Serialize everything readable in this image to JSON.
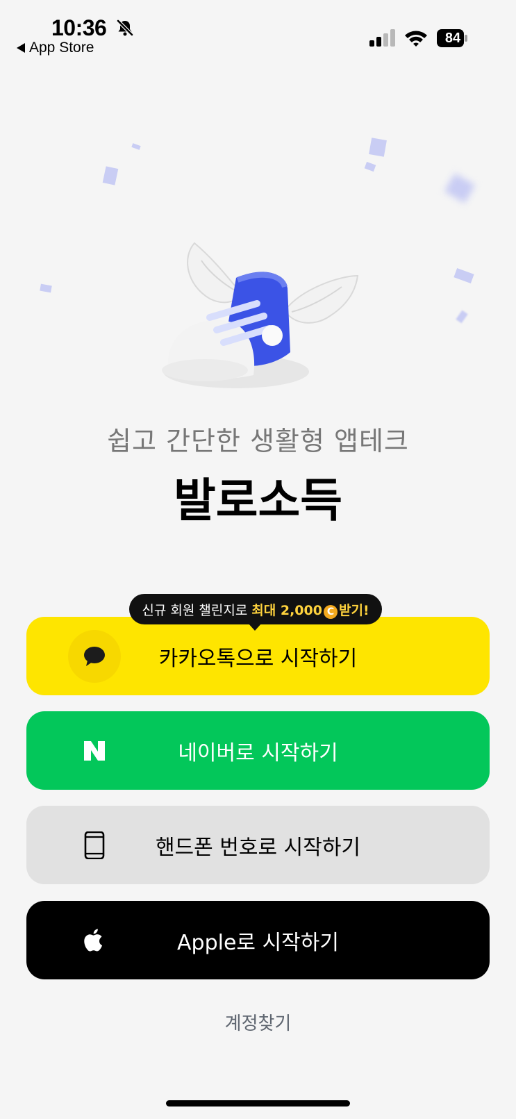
{
  "status_bar": {
    "time": "10:36",
    "back_label": "App Store",
    "battery": "84"
  },
  "hero": {
    "subtitle": "쉽고 간단한 생활형 앱테크",
    "title": "발로소득"
  },
  "tooltip": {
    "text": "신규 회원 챌린지로",
    "highlight_prefix": "최대 2,000",
    "coin": "C",
    "highlight_suffix": "받기!"
  },
  "buttons": {
    "kakao": "카카오톡으로 시작하기",
    "naver": "네이버로 시작하기",
    "phone": "핸드폰 번호로 시작하기",
    "apple": "Apple로 시작하기"
  },
  "footer": {
    "find_account": "계정찾기"
  },
  "colors": {
    "kakao": "#fee500",
    "naver": "#03c75a",
    "phone": "#e1e1e1",
    "apple": "#000000",
    "highlight": "#ffd33d"
  }
}
